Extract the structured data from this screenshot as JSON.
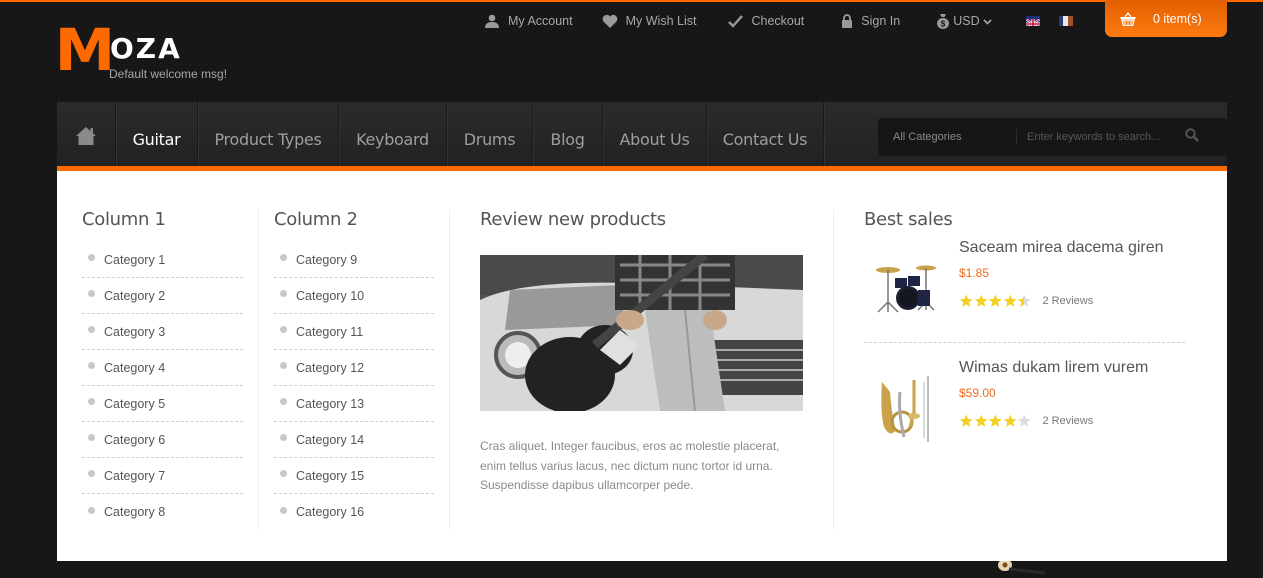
{
  "brand": {
    "logo_first": "M",
    "logo_rest": "OZA",
    "welcome": "Default welcome msg!",
    "accent_color": "#ff6a00"
  },
  "top_links": [
    {
      "label": "My Account",
      "icon": "user-icon"
    },
    {
      "label": "My Wish List",
      "icon": "heart-icon"
    },
    {
      "label": "Checkout",
      "icon": "check-icon"
    },
    {
      "label": "Sign In",
      "icon": "lock-icon"
    }
  ],
  "currency": {
    "label": "USD",
    "icon": "money-bag-icon"
  },
  "languages": [
    {
      "name": "English",
      "icon": "uk-flag-icon"
    },
    {
      "name": "French",
      "icon": "france-flag-icon"
    }
  ],
  "cart": {
    "label": "0 item(s)",
    "icon": "basket-icon"
  },
  "nav": {
    "home_icon": "home-icon",
    "items": [
      {
        "label": "Guitar",
        "active": true
      },
      {
        "label": "Product Types",
        "active": false
      },
      {
        "label": "Keyboard",
        "active": false
      },
      {
        "label": "Drums",
        "active": false
      },
      {
        "label": "Blog",
        "active": false
      },
      {
        "label": "About Us",
        "active": false
      },
      {
        "label": "Contact Us",
        "active": false
      }
    ]
  },
  "search": {
    "category": "All Categories",
    "placeholder": "Enter keywords to search...",
    "icon": "search-icon"
  },
  "mega_menu": {
    "column1": {
      "title": "Column 1",
      "items": [
        "Category 1",
        "Category 2",
        "Category 3",
        "Category 4",
        "Category 5",
        "Category 6",
        "Category 7",
        "Category 8"
      ]
    },
    "column2": {
      "title": "Column 2",
      "items": [
        "Category 9",
        "Category 10",
        "Category 11",
        "Category 12",
        "Category 13",
        "Category 14",
        "Category 15",
        "Category 16"
      ]
    },
    "review": {
      "title": "Review new products",
      "image": "guitar-player-photo",
      "text": "Cras aliquet. Integer faucibus, eros ac molestie placerat, enim tellus varius lacus, nec dictum nunc tortor id urna. Suspendisse dapibus ullamcorper pede."
    },
    "best_sales": {
      "title": "Best sales",
      "products": [
        {
          "name": "Saceam mirea dacema giren",
          "price": "$1.85",
          "rating": 4.5,
          "reviews": "2 Reviews",
          "image": "drum-kit"
        },
        {
          "name": "Wimas dukam lirem vurem",
          "price": "$59.00",
          "rating": 4,
          "reviews": "2 Reviews",
          "image": "brass-instruments"
        }
      ]
    }
  }
}
